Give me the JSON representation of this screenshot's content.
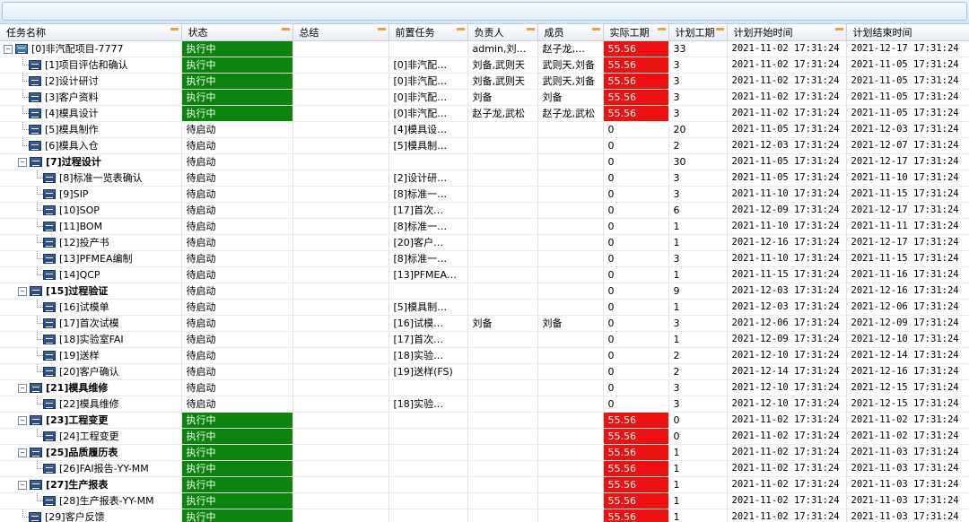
{
  "columns": [
    "任务名称",
    "状态",
    "总结",
    "前置任务",
    "负责人",
    "成员",
    "实际工期",
    "计划工期",
    "计划开始时间",
    "计划结束时间"
  ],
  "rows": [
    {
      "name": "[0]非汽配项目-7777",
      "level": 0,
      "toggle": "−",
      "bold": false,
      "status": "执行中",
      "active": true,
      "summary": "",
      "pred": "",
      "owner": "admin,刘…",
      "members": "赵子龙,…",
      "actual": "55.56",
      "planned": "33",
      "start": "2021-11-02 17:31:24",
      "end": "2021-12-17 17:31:24"
    },
    {
      "name": "[1]项目评估和确认",
      "level": 1,
      "toggle": "",
      "bold": false,
      "status": "执行中",
      "active": true,
      "summary": "",
      "pred": "[0]非汽配…",
      "owner": "刘备,武则天",
      "members": "武则天,刘备",
      "actual": "55.56",
      "planned": "3",
      "start": "2021-11-02 17:31:24",
      "end": "2021-11-05 17:31:24"
    },
    {
      "name": "[2]设计研讨",
      "level": 1,
      "toggle": "",
      "bold": false,
      "status": "执行中",
      "active": true,
      "summary": "",
      "pred": "[0]非汽配…",
      "owner": "刘备,武则天",
      "members": "武则天,刘备",
      "actual": "55.56",
      "planned": "3",
      "start": "2021-11-02 17:31:24",
      "end": "2021-11-05 17:31:24"
    },
    {
      "name": "[3]客户资料",
      "level": 1,
      "toggle": "",
      "bold": false,
      "status": "执行中",
      "active": true,
      "summary": "",
      "pred": "[0]非汽配…",
      "owner": "刘备",
      "members": "刘备",
      "actual": "55.56",
      "planned": "3",
      "start": "2021-11-02 17:31:24",
      "end": "2021-11-05 17:31:24"
    },
    {
      "name": "[4]模具设计",
      "level": 1,
      "toggle": "",
      "bold": false,
      "status": "执行中",
      "active": true,
      "summary": "",
      "pred": "[0]非汽配…",
      "owner": "赵子龙,武松",
      "members": "赵子龙,武松",
      "actual": "55.56",
      "planned": "3",
      "start": "2021-11-02 17:31:24",
      "end": "2021-11-05 17:31:24"
    },
    {
      "name": "[5]模具制作",
      "level": 1,
      "toggle": "",
      "bold": false,
      "status": "待启动",
      "active": false,
      "summary": "",
      "pred": "[4]模具设…",
      "owner": "",
      "members": "",
      "actual": "0",
      "planned": "20",
      "start": "2021-11-05 17:31:24",
      "end": "2021-12-03 17:31:24"
    },
    {
      "name": "[6]模具入仓",
      "level": 1,
      "toggle": "",
      "bold": false,
      "status": "待启动",
      "active": false,
      "summary": "",
      "pred": "[5]模具制…",
      "owner": "",
      "members": "",
      "actual": "0",
      "planned": "2",
      "start": "2021-12-03 17:31:24",
      "end": "2021-12-07 17:31:24"
    },
    {
      "name": "[7]过程设计",
      "level": 1,
      "toggle": "−",
      "bold": true,
      "status": "待启动",
      "active": false,
      "summary": "",
      "pred": "",
      "owner": "",
      "members": "",
      "actual": "0",
      "planned": "30",
      "start": "2021-11-05 17:31:24",
      "end": "2021-12-17 17:31:24"
    },
    {
      "name": "[8]标准一览表确认",
      "level": 2,
      "toggle": "",
      "bold": false,
      "status": "待启动",
      "active": false,
      "summary": "",
      "pred": "[2]设计研…",
      "owner": "",
      "members": "",
      "actual": "0",
      "planned": "3",
      "start": "2021-11-05 17:31:24",
      "end": "2021-11-10 17:31:24"
    },
    {
      "name": "[9]SIP",
      "level": 2,
      "toggle": "",
      "bold": false,
      "status": "待启动",
      "active": false,
      "summary": "",
      "pred": "[8]标准一…",
      "owner": "",
      "members": "",
      "actual": "0",
      "planned": "3",
      "start": "2021-11-10 17:31:24",
      "end": "2021-11-15 17:31:24"
    },
    {
      "name": "[10]SOP",
      "level": 2,
      "toggle": "",
      "bold": false,
      "status": "待启动",
      "active": false,
      "summary": "",
      "pred": "[17]首次…",
      "owner": "",
      "members": "",
      "actual": "0",
      "planned": "6",
      "start": "2021-12-09 17:31:24",
      "end": "2021-12-17 17:31:24"
    },
    {
      "name": "[11]BOM",
      "level": 2,
      "toggle": "",
      "bold": false,
      "status": "待启动",
      "active": false,
      "summary": "",
      "pred": "[8]标准一…",
      "owner": "",
      "members": "",
      "actual": "0",
      "planned": "1",
      "start": "2021-11-10 17:31:24",
      "end": "2021-11-11 17:31:24"
    },
    {
      "name": "[12]投产书",
      "level": 2,
      "toggle": "",
      "bold": false,
      "status": "待启动",
      "active": false,
      "summary": "",
      "pred": "[20]客户…",
      "owner": "",
      "members": "",
      "actual": "0",
      "planned": "1",
      "start": "2021-12-16 17:31:24",
      "end": "2021-12-17 17:31:24"
    },
    {
      "name": "[13]PFMEA编制",
      "level": 2,
      "toggle": "",
      "bold": false,
      "status": "待启动",
      "active": false,
      "summary": "",
      "pred": "[8]标准一…",
      "owner": "",
      "members": "",
      "actual": "0",
      "planned": "3",
      "start": "2021-11-10 17:31:24",
      "end": "2021-11-15 17:31:24"
    },
    {
      "name": "[14]QCP",
      "level": 2,
      "toggle": "",
      "bold": false,
      "status": "待启动",
      "active": false,
      "summary": "",
      "pred": "[13]PFMEA…",
      "owner": "",
      "members": "",
      "actual": "0",
      "planned": "1",
      "start": "2021-11-15 17:31:24",
      "end": "2021-11-16 17:31:24"
    },
    {
      "name": "[15]过程验证",
      "level": 1,
      "toggle": "−",
      "bold": true,
      "status": "待启动",
      "active": false,
      "summary": "",
      "pred": "",
      "owner": "",
      "members": "",
      "actual": "0",
      "planned": "9",
      "start": "2021-12-03 17:31:24",
      "end": "2021-12-16 17:31:24"
    },
    {
      "name": "[16]试模单",
      "level": 2,
      "toggle": "",
      "bold": false,
      "status": "待启动",
      "active": false,
      "summary": "",
      "pred": "[5]模具制…",
      "owner": "",
      "members": "",
      "actual": "0",
      "planned": "1",
      "start": "2021-12-03 17:31:24",
      "end": "2021-12-06 17:31:24"
    },
    {
      "name": "[17]首次试模",
      "level": 2,
      "toggle": "",
      "bold": false,
      "status": "待启动",
      "active": false,
      "summary": "",
      "pred": "[16]试模…",
      "owner": "刘备",
      "members": "刘备",
      "actual": "0",
      "planned": "3",
      "start": "2021-12-06 17:31:24",
      "end": "2021-12-09 17:31:24"
    },
    {
      "name": "[18]实验室FAI",
      "level": 2,
      "toggle": "",
      "bold": false,
      "status": "待启动",
      "active": false,
      "summary": "",
      "pred": "[17]首次…",
      "owner": "",
      "members": "",
      "actual": "0",
      "planned": "1",
      "start": "2021-12-09 17:31:24",
      "end": "2021-12-10 17:31:24"
    },
    {
      "name": "[19]送样",
      "level": 2,
      "toggle": "",
      "bold": false,
      "status": "待启动",
      "active": false,
      "summary": "",
      "pred": "[18]实验…",
      "owner": "",
      "members": "",
      "actual": "0",
      "planned": "2",
      "start": "2021-12-10 17:31:24",
      "end": "2021-12-14 17:31:24"
    },
    {
      "name": "[20]客户确认",
      "level": 2,
      "toggle": "",
      "bold": false,
      "status": "待启动",
      "active": false,
      "summary": "",
      "pred": "[19]送样(FS)",
      "owner": "",
      "members": "",
      "actual": "0",
      "planned": "2",
      "start": "2021-12-14 17:31:24",
      "end": "2021-12-16 17:31:24"
    },
    {
      "name": "[21]模具维修",
      "level": 1,
      "toggle": "−",
      "bold": true,
      "status": "待启动",
      "active": false,
      "summary": "",
      "pred": "",
      "owner": "",
      "members": "",
      "actual": "0",
      "planned": "3",
      "start": "2021-12-10 17:31:24",
      "end": "2021-12-15 17:31:24"
    },
    {
      "name": "[22]模具维修",
      "level": 2,
      "toggle": "",
      "bold": false,
      "status": "待启动",
      "active": false,
      "summary": "",
      "pred": "[18]实验…",
      "owner": "",
      "members": "",
      "actual": "0",
      "planned": "3",
      "start": "2021-12-10 17:31:24",
      "end": "2021-12-15 17:31:24"
    },
    {
      "name": "[23]工程变更",
      "level": 1,
      "toggle": "−",
      "bold": true,
      "status": "执行中",
      "active": true,
      "summary": "",
      "pred": "",
      "owner": "",
      "members": "",
      "actual": "55.56",
      "planned": "0",
      "start": "2021-11-02 17:31:24",
      "end": "2021-11-02 17:31:24"
    },
    {
      "name": "[24]工程变更",
      "level": 2,
      "toggle": "",
      "bold": false,
      "status": "执行中",
      "active": true,
      "summary": "",
      "pred": "",
      "owner": "",
      "members": "",
      "actual": "55.56",
      "planned": "0",
      "start": "2021-11-02 17:31:24",
      "end": "2021-11-02 17:31:24"
    },
    {
      "name": "[25]品质履历表",
      "level": 1,
      "toggle": "−",
      "bold": true,
      "status": "执行中",
      "active": true,
      "summary": "",
      "pred": "",
      "owner": "",
      "members": "",
      "actual": "55.56",
      "planned": "1",
      "start": "2021-11-02 17:31:24",
      "end": "2021-11-03 17:31:24"
    },
    {
      "name": "[26]FAI报告-YY-MM",
      "level": 2,
      "toggle": "",
      "bold": false,
      "status": "执行中",
      "active": true,
      "summary": "",
      "pred": "",
      "owner": "",
      "members": "",
      "actual": "55.56",
      "planned": "1",
      "start": "2021-11-02 17:31:24",
      "end": "2021-11-03 17:31:24"
    },
    {
      "name": "[27]生产报表",
      "level": 1,
      "toggle": "−",
      "bold": true,
      "status": "执行中",
      "active": true,
      "summary": "",
      "pred": "",
      "owner": "",
      "members": "",
      "actual": "55.56",
      "planned": "1",
      "start": "2021-11-02 17:31:24",
      "end": "2021-11-03 17:31:24"
    },
    {
      "name": "[28]生产报表-YY-MM",
      "level": 2,
      "toggle": "",
      "bold": false,
      "status": "执行中",
      "active": true,
      "summary": "",
      "pred": "",
      "owner": "",
      "members": "",
      "actual": "55.56",
      "planned": "1",
      "start": "2021-11-02 17:31:24",
      "end": "2021-11-03 17:31:24"
    },
    {
      "name": "[29]客户反馈",
      "level": 1,
      "toggle": "",
      "bold": false,
      "status": "执行中",
      "active": true,
      "summary": "",
      "pred": "",
      "owner": "",
      "members": "",
      "actual": "55.56",
      "planned": "1",
      "start": "2021-11-02 17:31:24",
      "end": "2021-11-03 17:31:24"
    }
  ],
  "colors": {
    "active_status": "#0c830c",
    "overdue_actual": "#ee1111",
    "header_mark": "#f0a040"
  }
}
